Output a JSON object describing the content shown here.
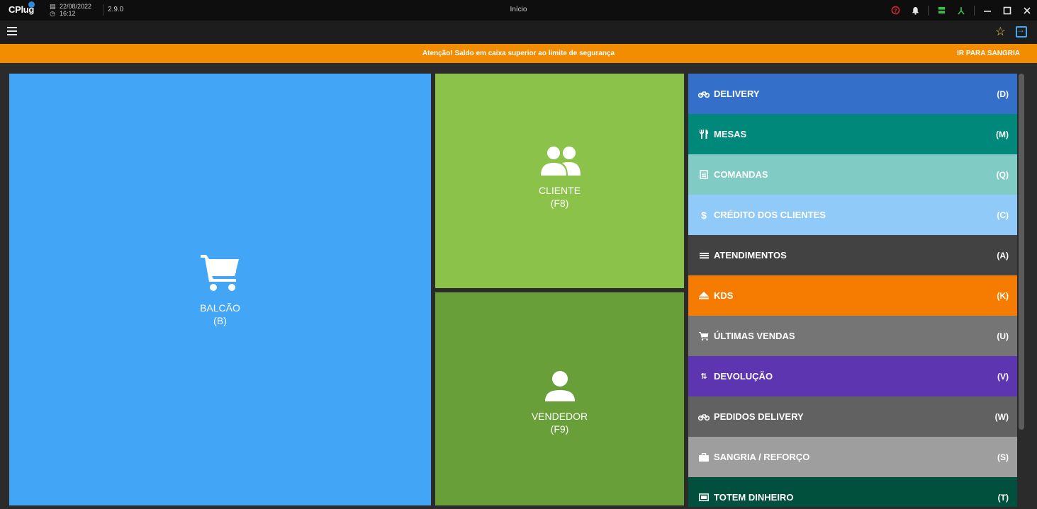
{
  "titlebar": {
    "logo": "CPlug",
    "date": "22/08/2022",
    "time": "16:12",
    "version": "2.9.0",
    "title": "Início"
  },
  "alert": {
    "message": "Atenção! Saldo em caixa superior ao limite de segurança",
    "action": "IR PARA SANGRIA"
  },
  "tiles": {
    "balcao": {
      "label": "BALCÃO",
      "key": "(B)",
      "color": "#42a5f5",
      "icon": "shopping-cart-icon"
    },
    "cliente": {
      "label": "CLIENTE",
      "key": "(F8)",
      "color": "#8bc34a",
      "icon": "people-icon"
    },
    "vendedor": {
      "label": "VENDEDOR",
      "key": "(F9)",
      "color": "#689f38",
      "icon": "person-icon"
    }
  },
  "menu": [
    {
      "label": "DELIVERY",
      "key": "(D)",
      "color": "#3470c9",
      "icon": "motorcycle-icon"
    },
    {
      "label": "MESAS",
      "key": "(M)",
      "color": "#00897b",
      "icon": "utensils-icon"
    },
    {
      "label": "COMANDAS",
      "key": "(Q)",
      "color": "#80cbc4",
      "icon": "receipt-icon"
    },
    {
      "label": "CRÉDITO DOS CLIENTES",
      "key": "(C)",
      "color": "#90caf9",
      "icon": "dollar-icon"
    },
    {
      "label": "ATENDIMENTOS",
      "key": "(A)",
      "color": "#424242",
      "icon": "list-icon"
    },
    {
      "label": "KDS",
      "key": "(K)",
      "color": "#f57c00",
      "icon": "eject-icon"
    },
    {
      "label": "ÚLTIMAS VENDAS",
      "key": "(U)",
      "color": "#757575",
      "icon": "cart-icon"
    },
    {
      "label": "DEVOLUÇÃO",
      "key": "(V)",
      "color": "#5e35b1",
      "icon": "swap-icon"
    },
    {
      "label": "PEDIDOS DELIVERY",
      "key": "(W)",
      "color": "#616161",
      "icon": "motorcycle-icon"
    },
    {
      "label": "SANGRIA / REFORÇO",
      "key": "(S)",
      "color": "#9e9e9e",
      "icon": "briefcase-icon"
    },
    {
      "label": "TOTEM DINHEIRO",
      "key": "(T)",
      "color": "#00503d",
      "icon": "cash-icon"
    }
  ]
}
